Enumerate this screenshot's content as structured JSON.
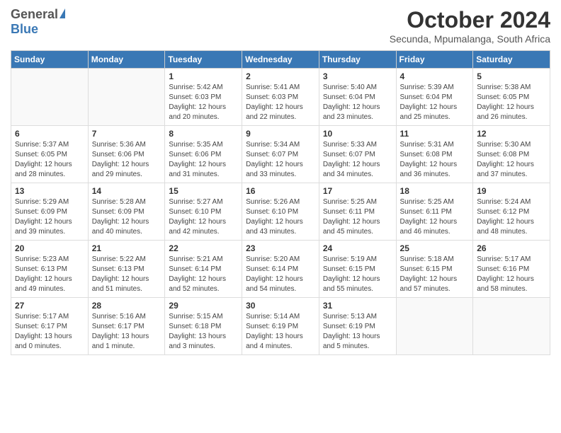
{
  "header": {
    "logo_general": "General",
    "logo_blue": "Blue",
    "title": "October 2024",
    "subtitle": "Secunda, Mpumalanga, South Africa"
  },
  "weekdays": [
    "Sunday",
    "Monday",
    "Tuesday",
    "Wednesday",
    "Thursday",
    "Friday",
    "Saturday"
  ],
  "weeks": [
    [
      {
        "day": "",
        "detail": ""
      },
      {
        "day": "",
        "detail": ""
      },
      {
        "day": "1",
        "detail": "Sunrise: 5:42 AM\nSunset: 6:03 PM\nDaylight: 12 hours\nand 20 minutes."
      },
      {
        "day": "2",
        "detail": "Sunrise: 5:41 AM\nSunset: 6:03 PM\nDaylight: 12 hours\nand 22 minutes."
      },
      {
        "day": "3",
        "detail": "Sunrise: 5:40 AM\nSunset: 6:04 PM\nDaylight: 12 hours\nand 23 minutes."
      },
      {
        "day": "4",
        "detail": "Sunrise: 5:39 AM\nSunset: 6:04 PM\nDaylight: 12 hours\nand 25 minutes."
      },
      {
        "day": "5",
        "detail": "Sunrise: 5:38 AM\nSunset: 6:05 PM\nDaylight: 12 hours\nand 26 minutes."
      }
    ],
    [
      {
        "day": "6",
        "detail": "Sunrise: 5:37 AM\nSunset: 6:05 PM\nDaylight: 12 hours\nand 28 minutes."
      },
      {
        "day": "7",
        "detail": "Sunrise: 5:36 AM\nSunset: 6:06 PM\nDaylight: 12 hours\nand 29 minutes."
      },
      {
        "day": "8",
        "detail": "Sunrise: 5:35 AM\nSunset: 6:06 PM\nDaylight: 12 hours\nand 31 minutes."
      },
      {
        "day": "9",
        "detail": "Sunrise: 5:34 AM\nSunset: 6:07 PM\nDaylight: 12 hours\nand 33 minutes."
      },
      {
        "day": "10",
        "detail": "Sunrise: 5:33 AM\nSunset: 6:07 PM\nDaylight: 12 hours\nand 34 minutes."
      },
      {
        "day": "11",
        "detail": "Sunrise: 5:31 AM\nSunset: 6:08 PM\nDaylight: 12 hours\nand 36 minutes."
      },
      {
        "day": "12",
        "detail": "Sunrise: 5:30 AM\nSunset: 6:08 PM\nDaylight: 12 hours\nand 37 minutes."
      }
    ],
    [
      {
        "day": "13",
        "detail": "Sunrise: 5:29 AM\nSunset: 6:09 PM\nDaylight: 12 hours\nand 39 minutes."
      },
      {
        "day": "14",
        "detail": "Sunrise: 5:28 AM\nSunset: 6:09 PM\nDaylight: 12 hours\nand 40 minutes."
      },
      {
        "day": "15",
        "detail": "Sunrise: 5:27 AM\nSunset: 6:10 PM\nDaylight: 12 hours\nand 42 minutes."
      },
      {
        "day": "16",
        "detail": "Sunrise: 5:26 AM\nSunset: 6:10 PM\nDaylight: 12 hours\nand 43 minutes."
      },
      {
        "day": "17",
        "detail": "Sunrise: 5:25 AM\nSunset: 6:11 PM\nDaylight: 12 hours\nand 45 minutes."
      },
      {
        "day": "18",
        "detail": "Sunrise: 5:25 AM\nSunset: 6:11 PM\nDaylight: 12 hours\nand 46 minutes."
      },
      {
        "day": "19",
        "detail": "Sunrise: 5:24 AM\nSunset: 6:12 PM\nDaylight: 12 hours\nand 48 minutes."
      }
    ],
    [
      {
        "day": "20",
        "detail": "Sunrise: 5:23 AM\nSunset: 6:13 PM\nDaylight: 12 hours\nand 49 minutes."
      },
      {
        "day": "21",
        "detail": "Sunrise: 5:22 AM\nSunset: 6:13 PM\nDaylight: 12 hours\nand 51 minutes."
      },
      {
        "day": "22",
        "detail": "Sunrise: 5:21 AM\nSunset: 6:14 PM\nDaylight: 12 hours\nand 52 minutes."
      },
      {
        "day": "23",
        "detail": "Sunrise: 5:20 AM\nSunset: 6:14 PM\nDaylight: 12 hours\nand 54 minutes."
      },
      {
        "day": "24",
        "detail": "Sunrise: 5:19 AM\nSunset: 6:15 PM\nDaylight: 12 hours\nand 55 minutes."
      },
      {
        "day": "25",
        "detail": "Sunrise: 5:18 AM\nSunset: 6:15 PM\nDaylight: 12 hours\nand 57 minutes."
      },
      {
        "day": "26",
        "detail": "Sunrise: 5:17 AM\nSunset: 6:16 PM\nDaylight: 12 hours\nand 58 minutes."
      }
    ],
    [
      {
        "day": "27",
        "detail": "Sunrise: 5:17 AM\nSunset: 6:17 PM\nDaylight: 13 hours\nand 0 minutes."
      },
      {
        "day": "28",
        "detail": "Sunrise: 5:16 AM\nSunset: 6:17 PM\nDaylight: 13 hours\nand 1 minute."
      },
      {
        "day": "29",
        "detail": "Sunrise: 5:15 AM\nSunset: 6:18 PM\nDaylight: 13 hours\nand 3 minutes."
      },
      {
        "day": "30",
        "detail": "Sunrise: 5:14 AM\nSunset: 6:19 PM\nDaylight: 13 hours\nand 4 minutes."
      },
      {
        "day": "31",
        "detail": "Sunrise: 5:13 AM\nSunset: 6:19 PM\nDaylight: 13 hours\nand 5 minutes."
      },
      {
        "day": "",
        "detail": ""
      },
      {
        "day": "",
        "detail": ""
      }
    ]
  ]
}
